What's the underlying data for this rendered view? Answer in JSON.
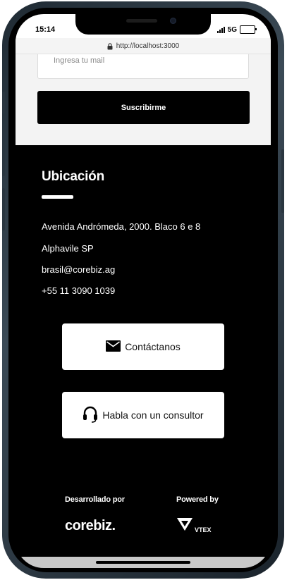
{
  "status_bar": {
    "time": "15:14",
    "network": "5G"
  },
  "browser": {
    "url": "http://localhost:3000"
  },
  "newsletter": {
    "email_placeholder": "Ingresa tu mail",
    "subscribe_label": "Suscribirme"
  },
  "location": {
    "title": "Ubicación",
    "address_line_1": "Avenida Andrómeda, 2000. Blaco 6 e 8",
    "address_line_2": "Alphavile SP",
    "email": "brasil@corebiz.ag",
    "phone": "+55 11 3090 1039"
  },
  "actions": {
    "contact_label": "Contáctanos",
    "consultant_label": "Habla con un consultor"
  },
  "credits": {
    "developed_by_label": "Desarrollado por",
    "powered_by_label": "Powered by",
    "developer_logo_text": "corebiz.",
    "platform_logo_text": "VTEX"
  },
  "colors": {
    "footer_background": "#000000",
    "newsletter_background": "#f3f3f3",
    "button_primary": "#000000"
  },
  "icons": {
    "lock": "lock-icon",
    "mail": "mail-icon",
    "headset": "headset-icon"
  }
}
